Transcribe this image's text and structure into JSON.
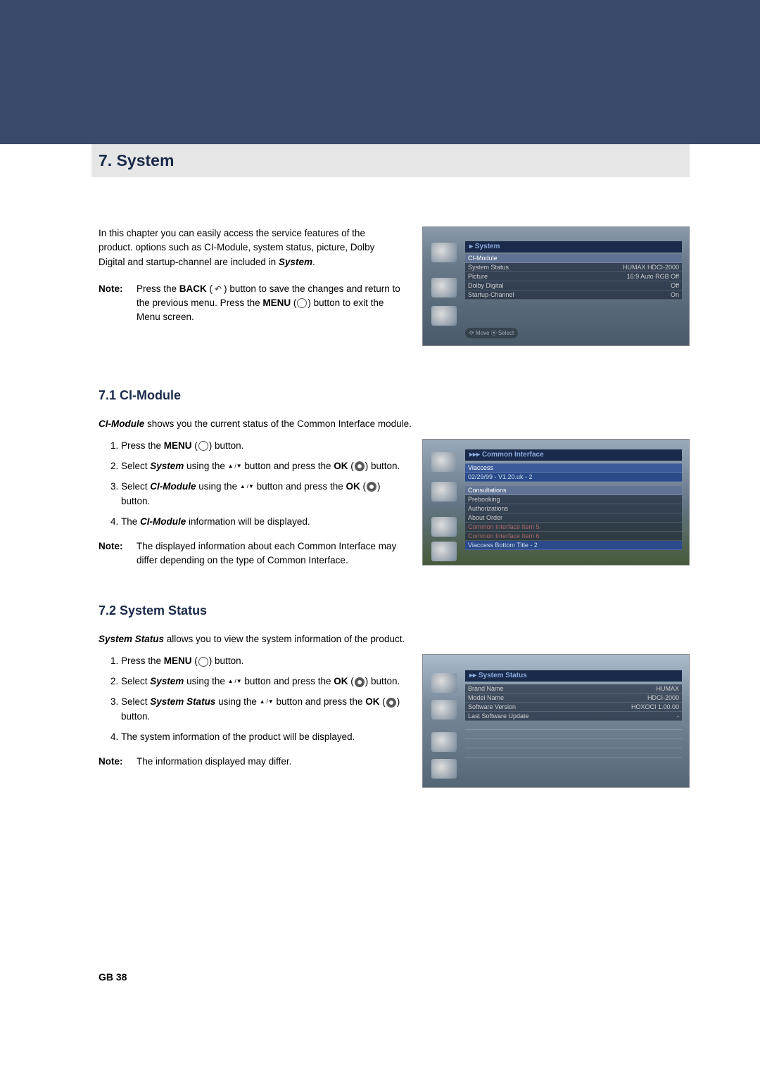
{
  "chapter": {
    "title": "7. System"
  },
  "intro": {
    "paragraph": "In this chapter you can easily access the service features of the product. options such as CI-Module, system status, picture, Dolby Digital and startup-channel are included in ",
    "paragraph_bold_tail": "System",
    "paragraph_tail": ".",
    "note_label": "Note:",
    "note_text_1": "Press the ",
    "note_back": "BACK",
    "note_text_2": " button to save the changes and return to the previous menu. Press the ",
    "note_menu": "MENU",
    "note_text_3": " button to exit the Menu screen."
  },
  "screenshot1": {
    "title": "▸ System",
    "rows": [
      {
        "k": "CI-Module",
        "v": ""
      },
      {
        "k": "System Status",
        "v": "HUMAX HDCI-2000"
      },
      {
        "k": "Picture",
        "v": "16:9 Auto RGB Off"
      },
      {
        "k": "Dolby Digital",
        "v": "Off"
      },
      {
        "k": "Startup-Channel",
        "v": "On"
      }
    ],
    "hint": "⟳ Move  ⦿ Select"
  },
  "sec71": {
    "heading": "7.1 CI-Module",
    "intro_bold": "CI-Module",
    "intro_rest": " shows you the current status of the Common Interface module.",
    "steps": {
      "s1_a": "Press the ",
      "s1_b": "MENU",
      "s1_c": " button.",
      "s2_a": "Select ",
      "s2_b": "System",
      "s2_c": " using the ",
      "s2_d": " button and press the ",
      "s2_e": "OK",
      "s2_f": " button.",
      "s3_a": "Select ",
      "s3_b": "CI-Module",
      "s3_c": " using the ",
      "s3_d": " button and press the ",
      "s3_e": "OK",
      "s3_f": " button.",
      "s4_a": "The ",
      "s4_b": "CI-Module",
      "s4_c": " information will be displayed."
    },
    "note_label": "Note:",
    "note_text": "The displayed information about each Common Interface may differ depending on the type of Common Interface."
  },
  "screenshot2": {
    "title": "▸▸▸ Common Interface",
    "rows": [
      {
        "k": "Viaccess",
        "v": ""
      },
      {
        "k": "02/29/99 - V1.20.uk - 2",
        "v": ""
      },
      {
        "k": "Consultations",
        "v": ""
      },
      {
        "k": "Prebooking",
        "v": ""
      },
      {
        "k": "Authorizations",
        "v": ""
      },
      {
        "k": "About Order",
        "v": ""
      },
      {
        "k": "Common Interface Item 5",
        "v": ""
      },
      {
        "k": "Common Interface Item 6",
        "v": ""
      },
      {
        "k": "Viaccess Bottom Title - 2",
        "v": ""
      }
    ]
  },
  "sec72": {
    "heading": "7.2 System Status",
    "intro_bold": "System Status",
    "intro_rest": " allows you to view the system information of the product.",
    "steps": {
      "s1_a": "Press the ",
      "s1_b": "MENU",
      "s1_c": " button.",
      "s2_a": "Select ",
      "s2_b": "System",
      "s2_c": " using the ",
      "s2_d": " button and press the ",
      "s2_e": "OK",
      "s2_f": " button.",
      "s3_a": "Select ",
      "s3_b": "System Status",
      "s3_c": " using the ",
      "s3_d": " button and press the ",
      "s3_e": "OK",
      "s3_f": " button.",
      "s4": "The system information of the product will be displayed."
    },
    "note_label": "Note:",
    "note_text": "The information displayed may differ."
  },
  "screenshot3": {
    "title": "▸▸ System Status",
    "rows": [
      {
        "k": "Brand Name",
        "v": "HUMAX"
      },
      {
        "k": "Model Name",
        "v": "HDCI-2000"
      },
      {
        "k": "Software Version",
        "v": "HOXOCI 1.00.00"
      },
      {
        "k": "Last Software Update",
        "v": "-"
      }
    ]
  },
  "footer": {
    "page": "GB 38"
  }
}
